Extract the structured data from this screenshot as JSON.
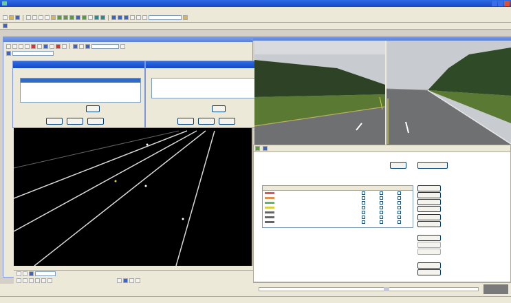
{
  "app": {
    "title": ""
  },
  "menu": [
    "",
    "",
    "",
    "",
    "",
    "",
    ""
  ],
  "toolbar2": {
    "label": ""
  },
  "left_pane": {
    "title": "",
    "toolbar_combo": "",
    "bottom_combo": ""
  },
  "dialog_a": {
    "title": "",
    "group_label": "",
    "rows": [
      "",
      "",
      "",
      "",
      ""
    ],
    "field_label": "",
    "field_value": "",
    "buttons": [
      "",
      "",
      ""
    ]
  },
  "dialog_b": {
    "title": "",
    "group_label": "",
    "rows": [
      "",
      "",
      "",
      ""
    ],
    "field_label": "",
    "field_value": "",
    "buttons": [
      "",
      "",
      ""
    ]
  },
  "right_panel": {
    "tabs": [
      "",
      ""
    ],
    "section_label": "",
    "top_buttons": [
      "",
      ""
    ],
    "list_label": "",
    "columns": [
      "",
      "",
      "",
      "",
      ""
    ],
    "rows": [
      {
        "name": "",
        "color": "#d02020"
      },
      {
        "name": "",
        "color": "#d86a10"
      },
      {
        "name": "",
        "color": "#2ea02e"
      },
      {
        "name": "",
        "color": "#c8c000"
      },
      {
        "name": "",
        "color": "#333333"
      },
      {
        "name": "",
        "color": "#333333"
      },
      {
        "name": "",
        "color": "#333333"
      }
    ],
    "side_buttons": [
      "",
      "",
      "",
      "",
      "",
      "",
      "",
      "",
      "",
      "",
      ""
    ]
  },
  "statusbar": {
    "text": ""
  },
  "colors": {
    "xp_blue": "#1f56d8",
    "lane_line": "#d8d8d8"
  }
}
